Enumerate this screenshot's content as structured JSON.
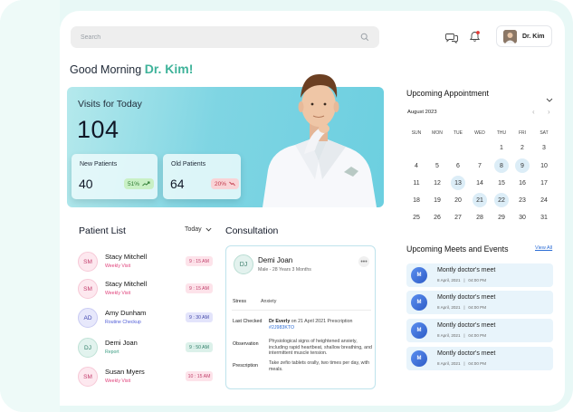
{
  "colors": {
    "accent": "#3fb39a",
    "link": "#2f6fd6",
    "hero_gradient_start": "#b5e9ec",
    "hero_gradient_end": "#6ccfe0",
    "calendar_highlight": "#dcedf7"
  },
  "search": {
    "placeholder": "Search"
  },
  "header": {
    "messages_icon": "chat-bubbles-icon",
    "notifications_icon": "bell-icon",
    "profile_name": "Dr. Kim"
  },
  "greeting": {
    "prefix": "Good Morning",
    "name": "Dr. Kim!"
  },
  "visits": {
    "title": "Visits for Today",
    "total": "104",
    "new_label": "New Patients",
    "new_value": "40",
    "new_change": "51%",
    "new_trend": "up",
    "old_label": "Old Patients",
    "old_value": "64",
    "old_change": "20%",
    "old_trend": "down"
  },
  "patient_list": {
    "title": "Patient List",
    "filter": "Today",
    "patients": [
      {
        "initials": "SM",
        "name": "Stacy Mitchell",
        "type": "Weekly Visit",
        "time": "9 : 15 AM",
        "type_color": "#e0407a",
        "avatar_bg": "#fde8ef",
        "avatar_fg": "#c33b6b",
        "time_bg": "#fde3ea",
        "time_fg": "#c0416c"
      },
      {
        "initials": "SM",
        "name": "Stacy Mitchell",
        "type": "Weekly Visit",
        "time": "9 : 15 AM",
        "type_color": "#e0407a",
        "avatar_bg": "#fde8ef",
        "avatar_fg": "#c33b6b",
        "time_bg": "#fde3ea",
        "time_fg": "#c0416c"
      },
      {
        "initials": "AD",
        "name": "Amy Dunham",
        "type": "Routine Checkup",
        "time": "9 : 30 AM",
        "type_color": "#4e5bd6",
        "avatar_bg": "#e7e8fb",
        "avatar_fg": "#3e46b0",
        "time_bg": "#e3e4fb",
        "time_fg": "#4348a8"
      },
      {
        "initials": "DJ",
        "name": "Demi Joan",
        "type": "Report",
        "time": "9 : 50 AM",
        "type_color": "#3a9d82",
        "avatar_bg": "#e2f3ee",
        "avatar_fg": "#2f7d68",
        "time_bg": "#dcf1ea",
        "time_fg": "#2f7d68"
      },
      {
        "initials": "SM",
        "name": "Susan Myers",
        "type": "Weekly Visit",
        "time": "10 : 15 AM",
        "type_color": "#e0407a",
        "avatar_bg": "#fde8ef",
        "avatar_fg": "#c33b6b",
        "time_bg": "#fde3ea",
        "time_fg": "#c0416c"
      }
    ]
  },
  "consultation": {
    "title": "Consultation",
    "initials": "DJ",
    "patient_name": "Demi Joan",
    "patient_meta": "Male - 28 Years 3 Months",
    "stress_label": "Stress",
    "stress_value": "Anxiety",
    "last_checked_label": "Last Checked",
    "last_checked_doctor": "Dr Everly",
    "last_checked_text": " on 21 April 2021 Prescription",
    "prescription_id": "#2J983KTO",
    "observation_label": "Observation",
    "observation_text": "Physiological signs of heightened anxiety, including rapid heartbeat, shallow breathing, and intermittent muscle tension.",
    "prescription_label": "Prescription",
    "prescription_text": "Take zefio tablets orally, two times per day, with meals."
  },
  "appointments": {
    "title": "Upcoming Appointment",
    "month": "August 2023",
    "weekdays": [
      "SUN",
      "MON",
      "TUE",
      "WED",
      "THU",
      "FRI",
      "SAT"
    ],
    "weeks": [
      [
        "",
        "",
        "",
        "",
        "",
        "",
        "1"
      ],
      [
        "2",
        "3",
        "4",
        "5",
        "6",
        "7",
        "8"
      ],
      [
        "9",
        "10",
        "11",
        "12",
        "13",
        "14",
        "15"
      ],
      [
        "16",
        "17",
        "18",
        "19",
        "20",
        "21",
        "22"
      ],
      [
        "23",
        "24",
        "25",
        "26",
        "27",
        "28",
        "29"
      ],
      [
        "30",
        "31",
        "",
        "",
        "",
        "",
        ""
      ]
    ],
    "highlighted_days": [
      "8",
      "9",
      "13",
      "21",
      "22"
    ]
  },
  "meets": {
    "title": "Upcoming Meets and Events",
    "view_all": "View All",
    "items": [
      {
        "initial": "M",
        "title": "Montly doctor's meet",
        "date": "8 April, 2021",
        "time": "04:00 PM"
      },
      {
        "initial": "M",
        "title": "Montly doctor's meet",
        "date": "8 April, 2021",
        "time": "04:00 PM"
      },
      {
        "initial": "M",
        "title": "Montly doctor's meet",
        "date": "8 April, 2021",
        "time": "04:00 PM"
      },
      {
        "initial": "M",
        "title": "Montly doctor's meet",
        "date": "8 April, 2021",
        "time": "04:00 PM"
      }
    ]
  }
}
